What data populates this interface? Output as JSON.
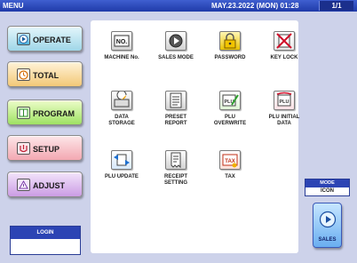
{
  "header": {
    "title": "MENU",
    "datetime": "MAY.23.2022 (MON) 01:28",
    "page": "1/1"
  },
  "sidebar": {
    "items": [
      {
        "label": "OPERATE",
        "icon": "operate-icon"
      },
      {
        "label": "TOTAL",
        "icon": "total-icon"
      },
      {
        "label": "PROGRAM",
        "icon": "program-icon"
      },
      {
        "label": "SETUP",
        "icon": "setup-icon"
      },
      {
        "label": "ADJUST",
        "icon": "adjust-icon"
      }
    ]
  },
  "login": {
    "label": "LOGIN",
    "value": ""
  },
  "tiles": [
    {
      "label": "MACHINE No.",
      "icon": "machine-number-icon",
      "glyph": "NO."
    },
    {
      "label": "SALES MODE",
      "icon": "sales-mode-icon",
      "glyph": "▶"
    },
    {
      "label": "PASSWORD",
      "icon": "padlock-icon",
      "glyph": "🔒"
    },
    {
      "label": "KEY LOCK",
      "icon": "key-lock-icon",
      "glyph": "✖"
    },
    {
      "label": "DATA\nSTORAGE",
      "icon": "data-storage-icon",
      "glyph": "◐"
    },
    {
      "label": "PRESET\nREPORT",
      "icon": "preset-report-icon",
      "glyph": "≡"
    },
    {
      "label": "PLU\nOVERWRITE",
      "icon": "plu-overwrite-icon",
      "glyph": "PLU"
    },
    {
      "label": "PLU INITIAL\nDATA",
      "icon": "plu-initial-data-icon",
      "glyph": "PLU"
    },
    {
      "label": "PLU UPDATE",
      "icon": "plu-update-icon",
      "glyph": "⇄"
    },
    {
      "label": "RECEIPT\nSETTING",
      "icon": "receipt-setting-icon",
      "glyph": "≡"
    },
    {
      "label": "TAX",
      "icon": "tax-icon",
      "glyph": "TAX"
    }
  ],
  "mode": {
    "label": "MODE",
    "value": "ICON"
  },
  "sales_button": {
    "label": "SALES",
    "icon": "sales-play-icon"
  }
}
